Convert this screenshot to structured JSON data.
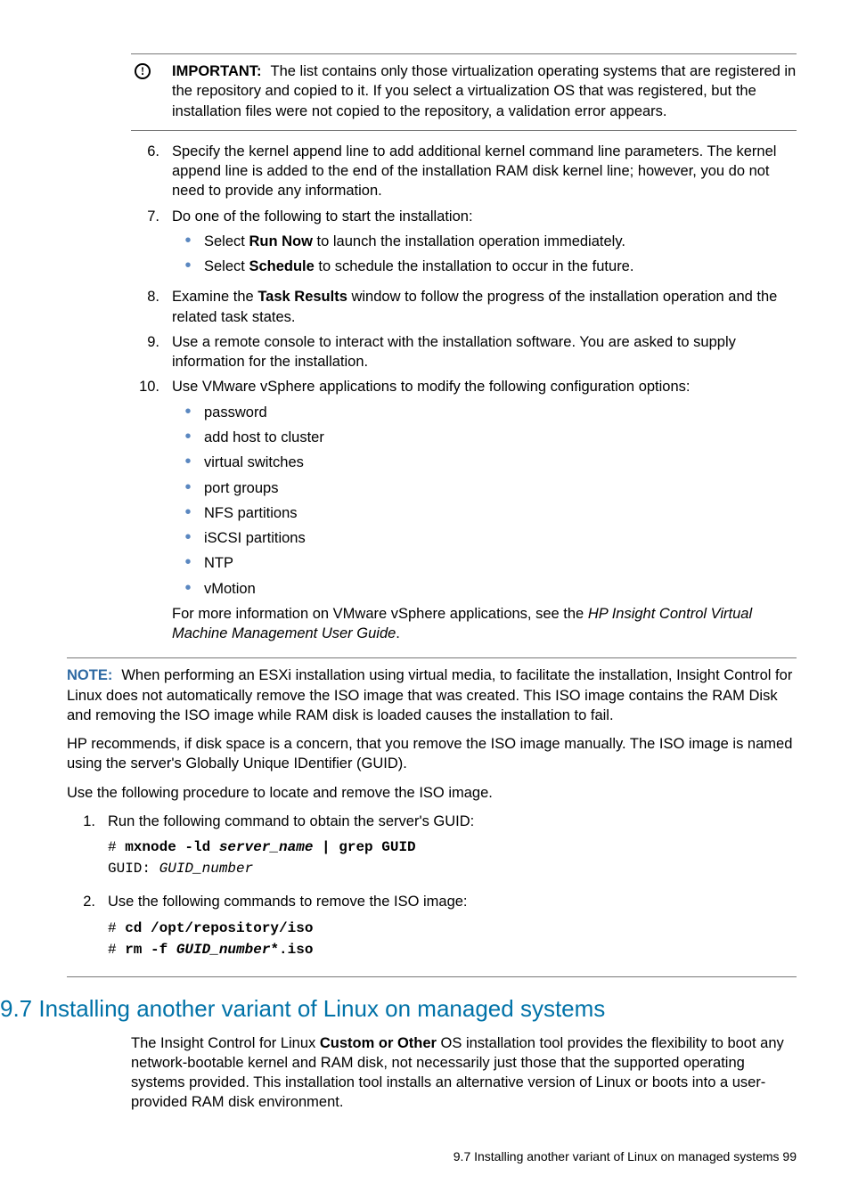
{
  "important": {
    "label": "IMPORTANT:",
    "text": "The list contains only those virtualization operating systems that are registered in the repository and copied to it. If you select a virtualization OS that was registered, but the installation files were not copied to the repository, a validation error appears."
  },
  "step6": {
    "num": "6.",
    "text": "Specify the kernel append line to add additional kernel command line parameters. The kernel append line is added to the end of the installation RAM disk kernel line; however, you do not need to provide any information."
  },
  "step7": {
    "num": "7.",
    "intro": "Do one of the following to start the installation:",
    "a_pre": "Select ",
    "a_bold": "Run Now",
    "a_post": " to launch the installation operation immediately.",
    "b_pre": "Select ",
    "b_bold": "Schedule",
    "b_post": " to schedule the installation to occur in the future."
  },
  "step8": {
    "num": "8.",
    "pre": "Examine the ",
    "bold": "Task Results",
    "post": " window to follow the progress of the installation operation and the related task states."
  },
  "step9": {
    "num": "9.",
    "text": "Use a remote console to interact with the installation software. You are asked to supply information for the installation."
  },
  "step10": {
    "num": "10.",
    "intro": "Use VMware vSphere applications to modify the following configuration options:",
    "items": [
      "password",
      "add host to cluster",
      "virtual switches",
      "port groups",
      "NFS partitions",
      "iSCSI partitions",
      "NTP",
      "vMotion"
    ],
    "tail_pre": "For more information on VMware vSphere applications, see the ",
    "tail_italic": "HP Insight Control Virtual Machine Management User Guide",
    "tail_post": "."
  },
  "note": {
    "label": "NOTE:",
    "p1": "When performing an ESXi installation using virtual media, to facilitate the installation, Insight Control for Linux does not automatically remove the ISO image that was created. This ISO image contains the RAM Disk and removing the ISO image while RAM disk is loaded causes the installation to fail.",
    "p2": "HP recommends, if disk space is a concern, that you remove the ISO image manually. The ISO image is named using the server's Globally Unique IDentifier (GUID).",
    "p3": "Use the following procedure to locate and remove the ISO image.",
    "s1": {
      "num": "1.",
      "text": "Run the following command to obtain the server's GUID:",
      "code_pre": "# ",
      "code_bold1": "mxnode -ld",
      "code_ital1": " server_name",
      "code_bold2": " | grep GUID",
      "line2_pre": "GUID: ",
      "line2_ital": "GUID_number"
    },
    "s2": {
      "num": "2.",
      "text": "Use the following commands to remove the ISO image:",
      "l1_pre": "# ",
      "l1_bold": "cd /opt/repository/iso",
      "l2_pre": "# ",
      "l2_bold": "rm -f ",
      "l2_ital": "GUID_number",
      "l2_bold2": "*.iso"
    }
  },
  "heading": "9.7 Installing another variant of Linux on managed systems",
  "headingPara_pre": "The Insight Control for Linux ",
  "headingPara_bold": "Custom or Other",
  "headingPara_post": " OS installation tool provides the flexibility to boot any network-bootable kernel and RAM disk, not necessarily just those that the supported operating systems provided. This installation tool installs an alternative version of Linux or boots into a user-provided RAM disk environment.",
  "footer": "9.7 Installing another variant of Linux on managed systems    99"
}
